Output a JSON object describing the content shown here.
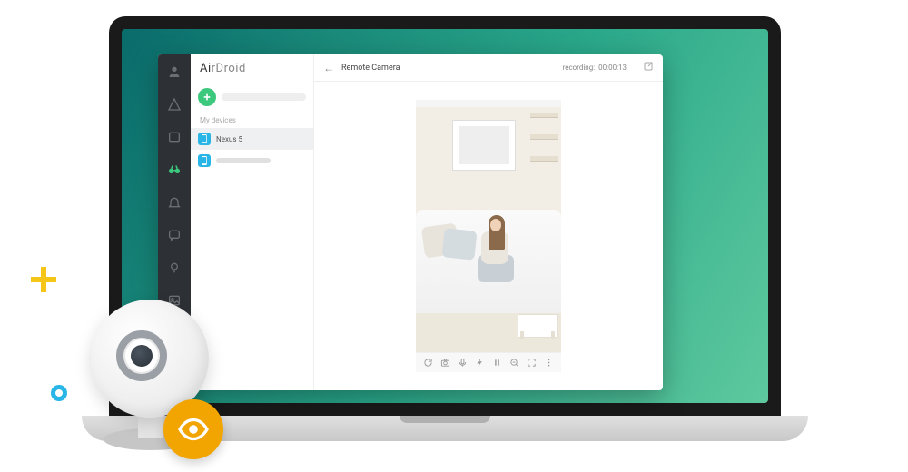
{
  "app": {
    "title_a": "Ai",
    "title_b": "rDroid"
  },
  "sidebar": {
    "section_label": "My devices",
    "devices": [
      {
        "name": "Nexus 5"
      },
      {
        "name": ""
      }
    ]
  },
  "header": {
    "title": "Remote Camera",
    "recording_label": "recording:",
    "recording_time": "00:00:13"
  },
  "controls": {
    "rotate": "rotate",
    "camera": "camera",
    "mic": "mic",
    "flash": "flash",
    "pause": "pause",
    "zoom_out": "zoom-out",
    "fullscreen": "fullscreen",
    "more": "more"
  },
  "colors": {
    "accent_green": "#3cc97e",
    "accent_blue": "#29b6e6",
    "badge_orange": "#f2a500",
    "plus_yellow": "#f5c518"
  }
}
